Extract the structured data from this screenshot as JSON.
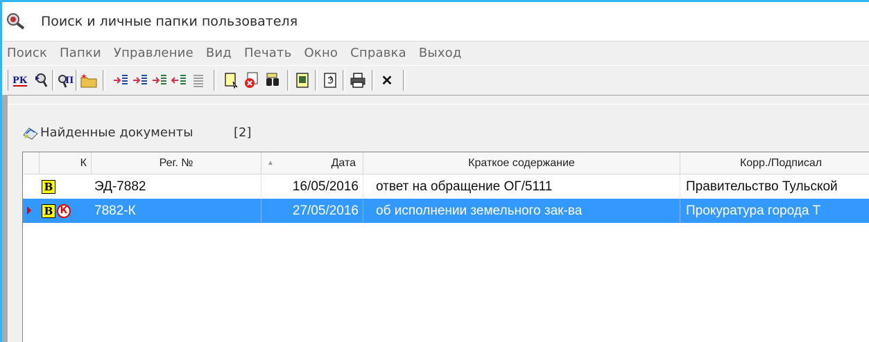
{
  "window": {
    "title": "Поиск и личные папки пользователя",
    "icon": "magnifier-icon"
  },
  "menu": {
    "items": [
      "Поиск",
      "Папки",
      "Управление",
      "Вид",
      "Печать",
      "Окно",
      "Справка",
      "Выход"
    ]
  },
  "toolbar": {
    "buttons": [
      {
        "name": "rk-search-icon",
        "label": "РК"
      },
      {
        "name": "search-doc-icon"
      },
      {
        "name": "project-search-icon",
        "label": "П"
      },
      {
        "name": "new-folder-icon"
      },
      {
        "name": "move-right-icon"
      },
      {
        "name": "move-left-icon"
      },
      {
        "name": "move-all-right-icon"
      },
      {
        "name": "move-all-left-icon"
      },
      {
        "name": "list-icon"
      },
      {
        "name": "doc-select-icon"
      },
      {
        "name": "doc-delete-icon"
      },
      {
        "name": "binoculars-icon"
      },
      {
        "name": "doc-view-icon"
      },
      {
        "name": "doc-refresh-icon"
      },
      {
        "name": "printer-icon"
      },
      {
        "name": "close-icon",
        "label": "✕"
      }
    ]
  },
  "panel": {
    "title": "Найденные документы",
    "count": "[2]",
    "icon": "documents-icon"
  },
  "grid": {
    "columns": [
      "К",
      "Рег. №",
      "Дата",
      "Краткое содержание",
      "Корр./Подписал"
    ],
    "sorted_column": "Дата",
    "rows": [
      {
        "badges": [
          "В"
        ],
        "reg_no": "ЭД-7882",
        "date": "16/05/2016",
        "summary": "ответ на обращение ОГ/5111",
        "corr": "Правительство Тульской",
        "selected": false
      },
      {
        "badges": [
          "В",
          "К"
        ],
        "reg_no": "7882-К",
        "date": "27/05/2016",
        "summary": "об исполнении земельного зак-ва",
        "corr": "Прокуратура города Т",
        "selected": true
      }
    ]
  },
  "colors": {
    "desktop": "#31b6f2",
    "selection": "#3399ff",
    "badge_b": "#ffff00",
    "badge_k": "#e00000"
  }
}
